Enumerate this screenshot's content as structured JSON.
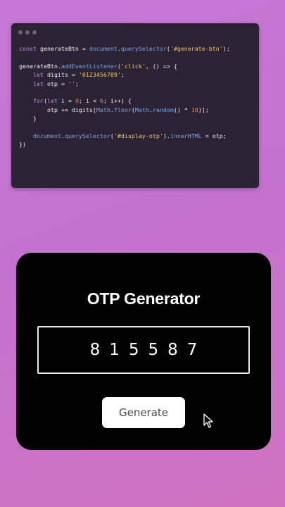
{
  "code_window": {
    "lines": [
      [
        {
          "t": "const",
          "c": "kw"
        },
        {
          "t": " generateBtn = ",
          "c": "plain"
        },
        {
          "t": "document",
          "c": "fn"
        },
        {
          "t": ".",
          "c": "plain"
        },
        {
          "t": "querySelector",
          "c": "fn"
        },
        {
          "t": "(",
          "c": "plain"
        },
        {
          "t": "'#generate-btn'",
          "c": "str"
        },
        {
          "t": ");",
          "c": "plain"
        }
      ],
      [],
      [
        {
          "t": "generateBtn",
          "c": "plain"
        },
        {
          "t": ".",
          "c": "plain"
        },
        {
          "t": "addEventListener",
          "c": "fn"
        },
        {
          "t": "(",
          "c": "plain"
        },
        {
          "t": "'click'",
          "c": "str"
        },
        {
          "t": ", () => {",
          "c": "plain"
        }
      ],
      [
        {
          "t": "    ",
          "c": "plain"
        },
        {
          "t": "let",
          "c": "kw"
        },
        {
          "t": " digits = ",
          "c": "plain"
        },
        {
          "t": "'0123456789'",
          "c": "str"
        },
        {
          "t": ";",
          "c": "plain"
        }
      ],
      [
        {
          "t": "    ",
          "c": "plain"
        },
        {
          "t": "let",
          "c": "kw"
        },
        {
          "t": " otp = ",
          "c": "plain"
        },
        {
          "t": "''",
          "c": "str"
        },
        {
          "t": ";",
          "c": "plain"
        }
      ],
      [],
      [
        {
          "t": "    ",
          "c": "plain"
        },
        {
          "t": "for",
          "c": "kw"
        },
        {
          "t": "(",
          "c": "plain"
        },
        {
          "t": "let",
          "c": "kw"
        },
        {
          "t": " i = ",
          "c": "plain"
        },
        {
          "t": "0",
          "c": "num"
        },
        {
          "t": "; i < ",
          "c": "plain"
        },
        {
          "t": "6",
          "c": "num"
        },
        {
          "t": "; i++) {",
          "c": "plain"
        }
      ],
      [
        {
          "t": "        otp += digits[",
          "c": "plain"
        },
        {
          "t": "Math",
          "c": "fn"
        },
        {
          "t": ".",
          "c": "plain"
        },
        {
          "t": "floor",
          "c": "fn"
        },
        {
          "t": "(",
          "c": "plain"
        },
        {
          "t": "Math",
          "c": "fn"
        },
        {
          "t": ".",
          "c": "plain"
        },
        {
          "t": "random",
          "c": "fn"
        },
        {
          "t": "() * ",
          "c": "plain"
        },
        {
          "t": "10",
          "c": "num"
        },
        {
          "t": ")];",
          "c": "plain"
        }
      ],
      [
        {
          "t": "    }",
          "c": "plain"
        }
      ],
      [],
      [
        {
          "t": "    ",
          "c": "plain"
        },
        {
          "t": "document",
          "c": "fn"
        },
        {
          "t": ".",
          "c": "plain"
        },
        {
          "t": "querySelector",
          "c": "fn"
        },
        {
          "t": "(",
          "c": "plain"
        },
        {
          "t": "'#display-otp'",
          "c": "str"
        },
        {
          "t": ").",
          "c": "plain"
        },
        {
          "t": "innerHTML",
          "c": "fn"
        },
        {
          "t": " = otp;",
          "c": "plain"
        }
      ],
      [
        {
          "t": "})",
          "c": "plain"
        }
      ]
    ]
  },
  "otp_card": {
    "title": "OTP Generator",
    "otp_value": "815587",
    "generate_label": "Generate"
  },
  "colors": {
    "keyword": "#c387e6",
    "function": "#76a7ef",
    "string": "#f2c56b",
    "number": "#f07f5e",
    "card_bg": "#020202",
    "page_bg": "#c678d6"
  },
  "icons": {
    "window_controls": "three-dots-icon",
    "cursor": "mouse-pointer-icon"
  }
}
